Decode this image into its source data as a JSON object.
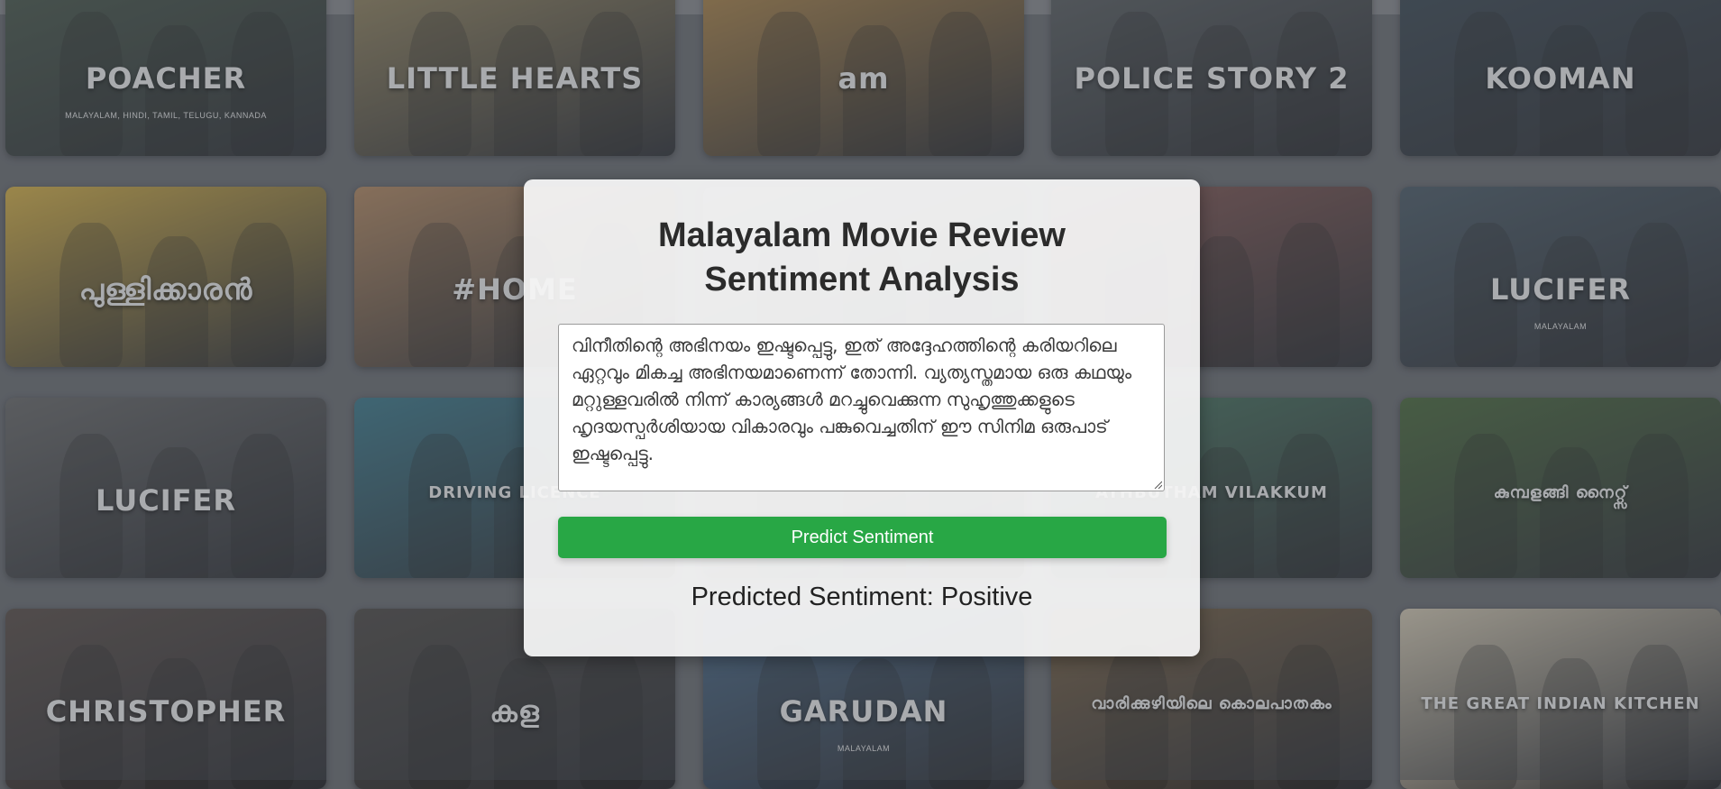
{
  "background": {
    "posters": [
      {
        "title": "POACHER",
        "subtitle": "MALAYALAM, HINDI, TAMIL, TELUGU, KANNADA",
        "color": "#4a5a4c"
      },
      {
        "title": "LITTLE HEARTS",
        "subtitle": "",
        "color": "#9a8a62"
      },
      {
        "title": "am",
        "subtitle": "",
        "color": "#b58a4a"
      },
      {
        "title": "POLICE STORY 2",
        "subtitle": "",
        "color": "#5d6264"
      },
      {
        "title": "KOOMAN",
        "subtitle": "",
        "color": "#3c4a55"
      },
      {
        "title": "പുള്ളിക്കാരൻ",
        "subtitle": "",
        "color": "#d8b246"
      },
      {
        "title": "#HOME",
        "subtitle": "",
        "color": "#b58a62"
      },
      {
        "title": "",
        "subtitle": "",
        "color": "#7c7f84"
      },
      {
        "title": "",
        "subtitle": "",
        "color": "#8a5a55"
      },
      {
        "title": "LUCIFER",
        "subtitle": "MALAYALAM",
        "color": "#4c5c68"
      },
      {
        "title": "LUCIFER",
        "subtitle": "",
        "color": "#6a6a6a"
      },
      {
        "title": "DRIVING LICENCE",
        "subtitle": "",
        "color": "#3c7a8c"
      },
      {
        "title": "",
        "subtitle": "",
        "color": "#7c8a7a"
      },
      {
        "title": "ATHBUTHAM VILAKKUM",
        "subtitle": "",
        "color": "#4a7a62"
      },
      {
        "title": "കുമ്പളങ്ങി നൈറ്റ്സ്",
        "subtitle": "",
        "color": "#4a6a3c"
      },
      {
        "title": "CHRISTOPHER",
        "subtitle": "",
        "color": "#5a4e48"
      },
      {
        "title": "കള",
        "subtitle": "",
        "color": "#4e4a46"
      },
      {
        "title": "GARUDAN",
        "subtitle": "MALAYALAM",
        "color": "#4a6a8a"
      },
      {
        "title": "വാരിക്കുഴിയിലെ കൊലപാതകം",
        "subtitle": "",
        "color": "#7a6244"
      },
      {
        "title": "THE GREAT INDIAN KITCHEN",
        "subtitle": "",
        "color": "#d6cbb4"
      }
    ]
  },
  "card": {
    "title_line1": "Malayalam Movie Review",
    "title_line2": "Sentiment Analysis",
    "review_text": "വിനീതിന്റെ അഭിനയം ഇഷ്ടപ്പെട്ടു, ഇത് അദ്ദേഹത്തിന്റെ കരിയറിലെ ഏറ്റവും മികച്ച അഭിനയമാണെന്ന് തോന്നി. വ്യത്യസ്തമായ ഒരു കഥയും മറ്റുള്ളവരിൽ നിന്ന് കാര്യങ്ങൾ മറച്ചുവെക്കുന്ന സുഹൃത്തുക്കളുടെ ഹൃദയസ്പർശിയായ വികാരവും പങ്കുവെച്ചതിന് ഈ സിനിമ ഒരുപാട് ഇഷ്ടപ്പെട്ടു.",
    "button_label": "Predict Sentiment",
    "result_text": "Predicted Sentiment: Positive",
    "button_color": "#28a745"
  }
}
